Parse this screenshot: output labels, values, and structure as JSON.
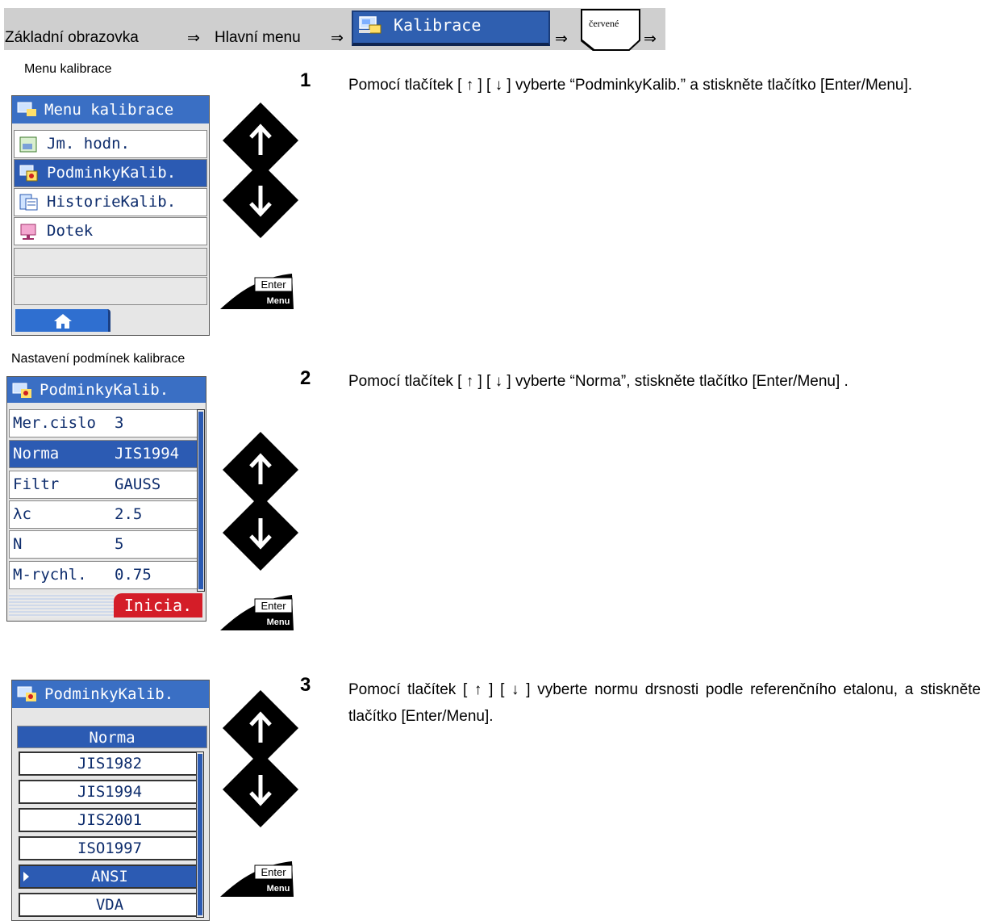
{
  "breadcrumb": {
    "part1": "Základní obrazovka",
    "part2": "Hlavní menu",
    "arrow": "⇒",
    "kalibrace_button": "Kalibrace",
    "red_key_label": "červené"
  },
  "section1": {
    "caption": "Menu kalibrace",
    "screen_title": "Menu kalibrace",
    "items": [
      "Jm. hodn.",
      "PodminkyKalib.",
      "HistorieKalib.",
      "Dotek"
    ],
    "selected_index": 1
  },
  "section2": {
    "caption": "Nastavení podmínek kalibrace",
    "screen_title": "PodminkyKalib.",
    "rows": [
      {
        "key": "Mer.cislo",
        "value": "3"
      },
      {
        "key": "Norma",
        "value": "JIS1994"
      },
      {
        "key": "Filtr",
        "value": "GAUSS"
      },
      {
        "key": "λc",
        "value": "2.5"
      },
      {
        "key": "N",
        "value": "5"
      },
      {
        "key": "M-rychl.",
        "value": "0.75"
      }
    ],
    "selected_index": 1,
    "inicia_button": "Inicia."
  },
  "section3": {
    "screen_title": "PodminkyKalib.",
    "list_header": "Norma",
    "options": [
      "JIS1982",
      "JIS1994",
      "JIS2001",
      "ISO1997",
      "ANSI",
      "VDA"
    ],
    "selected_index": 4
  },
  "keys": {
    "up_symbol": "↑",
    "down_symbol": "↓",
    "enter_top": "Enter",
    "enter_bottom": "Menu"
  },
  "steps": [
    {
      "number": "1",
      "text": "Pomocí tlačítek [ ↑ ] [ ↓ ] vyberte “PodminkyKalib.” a stiskněte tlačítko [Enter/Menu]."
    },
    {
      "number": "2",
      "text": "Pomocí tlačítek [ ↑ ] [ ↓ ] vyberte “Norma”, stiskněte tlačítko [Enter/Menu] ."
    },
    {
      "number": "3",
      "text": "Pomocí tlačítek [ ↑ ] [ ↓ ] vyberte normu drsnosti podle referenčního etalonu, a stiskněte tlačítko [Enter/Menu]."
    }
  ],
  "colors": {
    "title_blue": "#3a6fc4",
    "select_blue": "#2c5bb3",
    "inicia_red": "#d41d28",
    "crumb_gray": "#cfcfcf"
  }
}
